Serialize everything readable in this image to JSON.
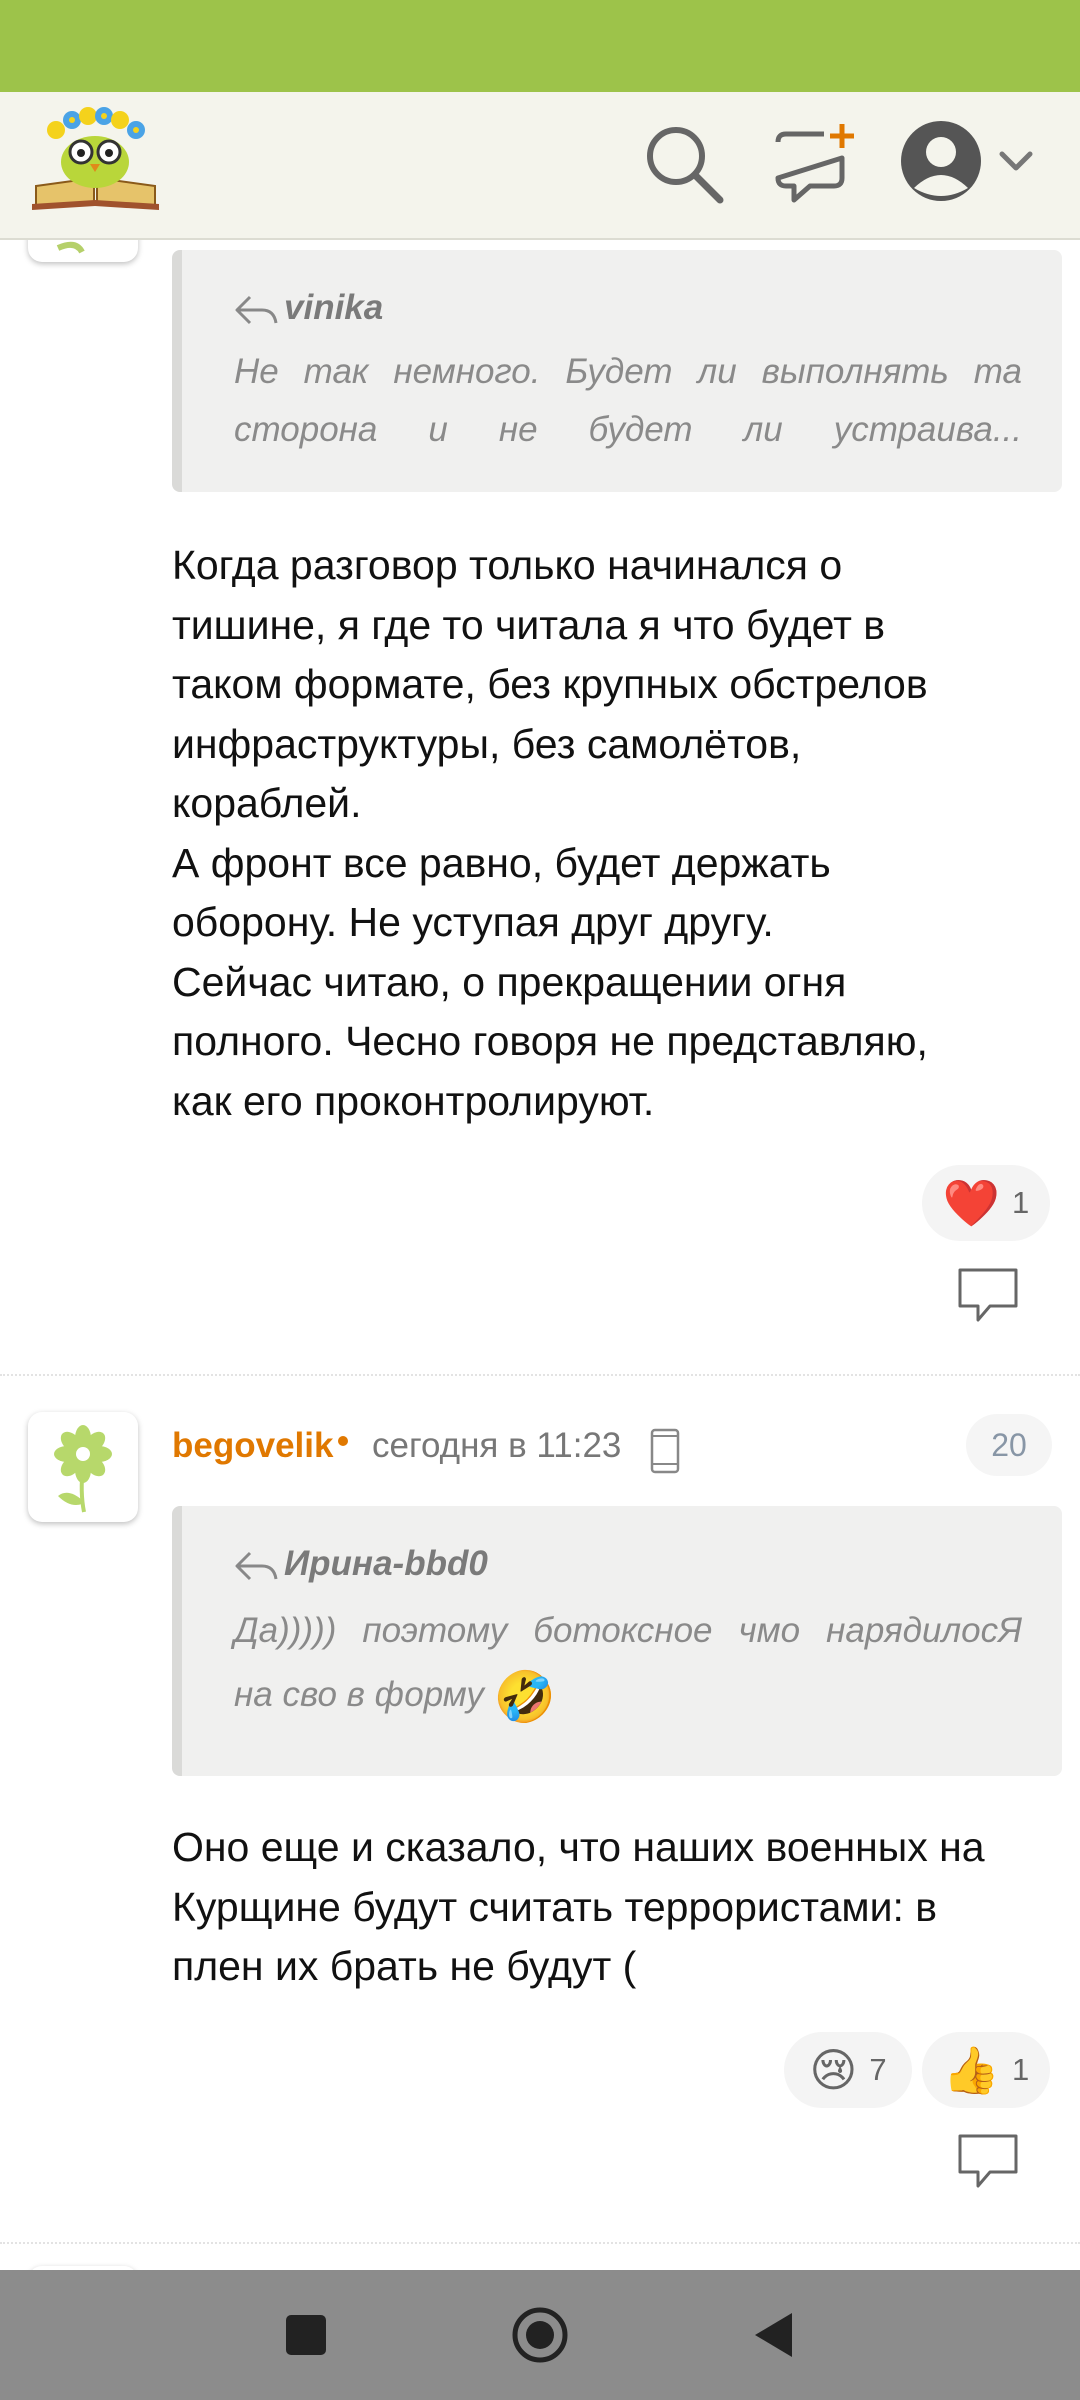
{
  "colors": {
    "status_bar": "#9dc34a",
    "accent": "#e07800",
    "nav_bar": "#8c8c8c"
  },
  "header": {
    "logo_icon": "owl-on-book-logo",
    "search_icon": "search-icon",
    "new_post_icon": "new-post-icon",
    "account_icon": "user-avatar-icon",
    "account_menu_icon": "chevron-down-icon"
  },
  "comments": [
    {
      "avatar_icon": "flower-avatar",
      "quote": {
        "author": "vinika",
        "lines": [
          "Не так немного. Будет ли выполнять та",
          "сторона и не будет ли устраива..."
        ]
      },
      "body": "Когда разговор только начинался о\nтишине, я где то читала я что будет в\nтаком формате, без крупных обстрелов\nинфраструктуры, без самолётов,\nкораблей.\nА фронт все равно, будет держать\nоборону. Не уступая друг другу.\nСейчас читаю, о прекращении огня\nполного. Чесно говоря не представляю,\nкак его проконтролируют.",
      "reactions": [
        {
          "emoji": "❤️",
          "count": "1"
        }
      ]
    },
    {
      "avatar_icon": "flower-avatar",
      "username": "begovelik",
      "timestamp": "сегодня в 11:23",
      "device_icon": "mobile-phone-icon",
      "number": "20",
      "quote": {
        "author": "Ирина-bbd0",
        "lines": [
          "Да))))) поэтому ботоксное чмо нарядилосЯ",
          "на сво в форму"
        ],
        "emoji": "🤣"
      },
      "body": "Оно еще и сказало, что наших военных на\nКурщине будут считать террористами: в\nплен их брать не будут (",
      "reactions": [
        {
          "emoji": "😢",
          "count": "7"
        },
        {
          "emoji": "👍",
          "count": "1"
        }
      ]
    }
  ],
  "navigation": {
    "recent_icon": "square-recents-icon",
    "home_icon": "circle-home-icon",
    "back_icon": "triangle-back-icon"
  }
}
